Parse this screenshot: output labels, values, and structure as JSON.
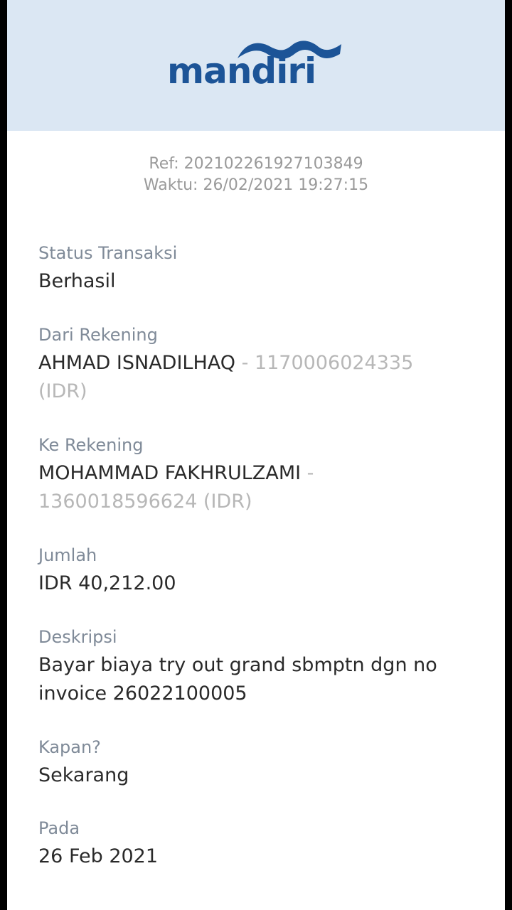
{
  "brand": {
    "name": "mandiri",
    "color": "#1c5497",
    "wave_color": "#1c5497"
  },
  "header_bg": "#dbe7f3",
  "receipt": {
    "ref": "Ref: 20210226192710384​9",
    "time": "Waktu: 26/02/2021 19:27:15"
  },
  "fields": {
    "status": {
      "label": "Status Transaksi",
      "value": "Berhasil"
    },
    "from": {
      "label": "Dari Rekening",
      "name": "AHMAD ISNADILHAQ",
      "separator": " - ",
      "account": "1170006024335",
      "currency": "(IDR)"
    },
    "to": {
      "label": "Ke Rekening",
      "name": "MOHAMMAD FAKHRULZAMI",
      "separator": " -",
      "account": "1360018596624",
      "currency": "(IDR)"
    },
    "amount": {
      "label": "Jumlah",
      "value": "IDR 40,212.00"
    },
    "description": {
      "label": "Deskripsi",
      "value": "Bayar biaya try out grand sbmptn dgn no invoice 26022100005"
    },
    "when": {
      "label": "Kapan?",
      "value": "Sekarang"
    },
    "date": {
      "label": "Pada",
      "value": "26 Feb 2021"
    }
  }
}
